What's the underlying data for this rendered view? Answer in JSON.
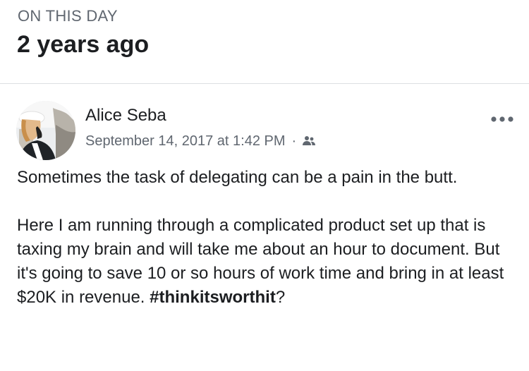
{
  "memory": {
    "kicker": "ON THIS DAY",
    "title": "2 years ago"
  },
  "post": {
    "author": "Alice Seba",
    "timestamp": "September 14, 2017 at 1:42 PM",
    "separator": "·",
    "audience_icon": "friends-icon",
    "more_icon": "more-options-icon",
    "paragraph_1": "Sometimes the task of delegating can be a pain in the butt.",
    "paragraph_2_text": "Here I am running through a complicated product set up that is  taxing my brain and will take me about an hour to document. But it's going to save 10 or so hours of work time and bring in at least $20K in revenue. ",
    "hashtag": "#thinkitsworthit",
    "paragraph_2_end": "?"
  },
  "colors": {
    "text_primary": "#1c1e21",
    "text_secondary": "#606770",
    "divider": "#dddfe2",
    "background": "#ffffff"
  }
}
